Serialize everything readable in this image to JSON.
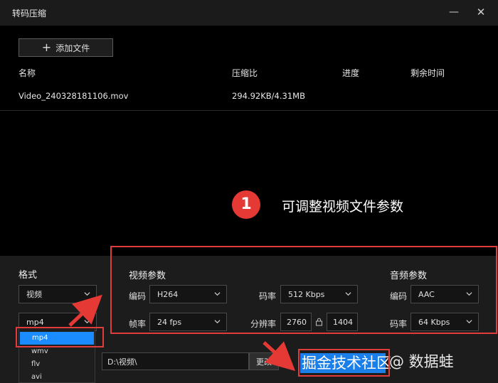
{
  "window": {
    "title": "转码压缩",
    "minimize_glyph": "—",
    "close_glyph": "✕"
  },
  "toolbar": {
    "add_file_label": "添加文件",
    "add_icon": "plus-icon"
  },
  "file_table": {
    "columns": [
      "名称",
      "压缩比",
      "进度",
      "剩余时间"
    ],
    "rows": [
      {
        "name": "Video_240328181106.mov",
        "ratio": "294.92KB/4.31MB",
        "progress": "",
        "remaining": ""
      }
    ]
  },
  "callout": {
    "number": "1",
    "text": "可调整视频文件参数"
  },
  "format": {
    "label": "格式",
    "type_value": "视频",
    "container_value": "mp4",
    "options": [
      "mp4",
      "wmv",
      "flv",
      "avi"
    ]
  },
  "video_params": {
    "title": "视频参数",
    "codec_label": "编码",
    "codec_value": "H264",
    "bitrate_label": "码率",
    "bitrate_value": "512 Kbps",
    "framerate_label": "帧率",
    "framerate_value": "24 fps",
    "resolution_label": "分辨率",
    "width_value": "2760",
    "height_value": "1404",
    "lock_icon": "lock-icon"
  },
  "audio_params": {
    "title": "音频参数",
    "codec_label": "编码",
    "codec_value": "AAC",
    "bitrate_label": "码率",
    "bitrate_value": "64 Kbps"
  },
  "output": {
    "path_value": "D:\\视频\\",
    "change_label": "更改"
  },
  "start_button_label": "掘金技术社区",
  "watermark": "@ 数据蛙",
  "colors": {
    "annotation_red": "#e03c3c",
    "accent_blue": "#1a7fe8",
    "badge_red": "#e53935"
  }
}
